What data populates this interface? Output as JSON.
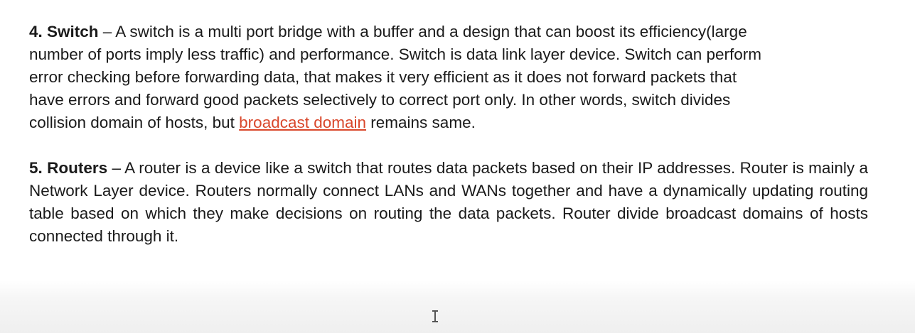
{
  "switch": {
    "heading": "4. Switch",
    "body_before_link": " – A switch is a multi port bridge with a buffer and a design that can boost its efficiency(large number of  ports imply less traffic) and performance. Switch is data link layer device. Switch can perform error checking before forwarding data, that makes it very efficient as it does not forward packets that have errors and  forward good packets selectively to correct port only.  In other words, switch divides collision domain of hosts, but ",
    "link_text": "broadcast domain",
    "body_after_link": " remains same."
  },
  "routers": {
    "heading": "5. Routers",
    "body": " – A router is a device like a switch that routes data packets based on their IP addresses. Router is mainly a Network Layer device. Routers normally connect LANs and WANs together and have a dynamically updating routing table based on which they make decisions on routing the data packets. Router divide broadcast domains of hosts connected through it."
  },
  "colors": {
    "text": "#1a1a1a",
    "link": "#d9472b",
    "background": "#ffffff"
  },
  "cursor_icon": "text-cursor-ibeam"
}
